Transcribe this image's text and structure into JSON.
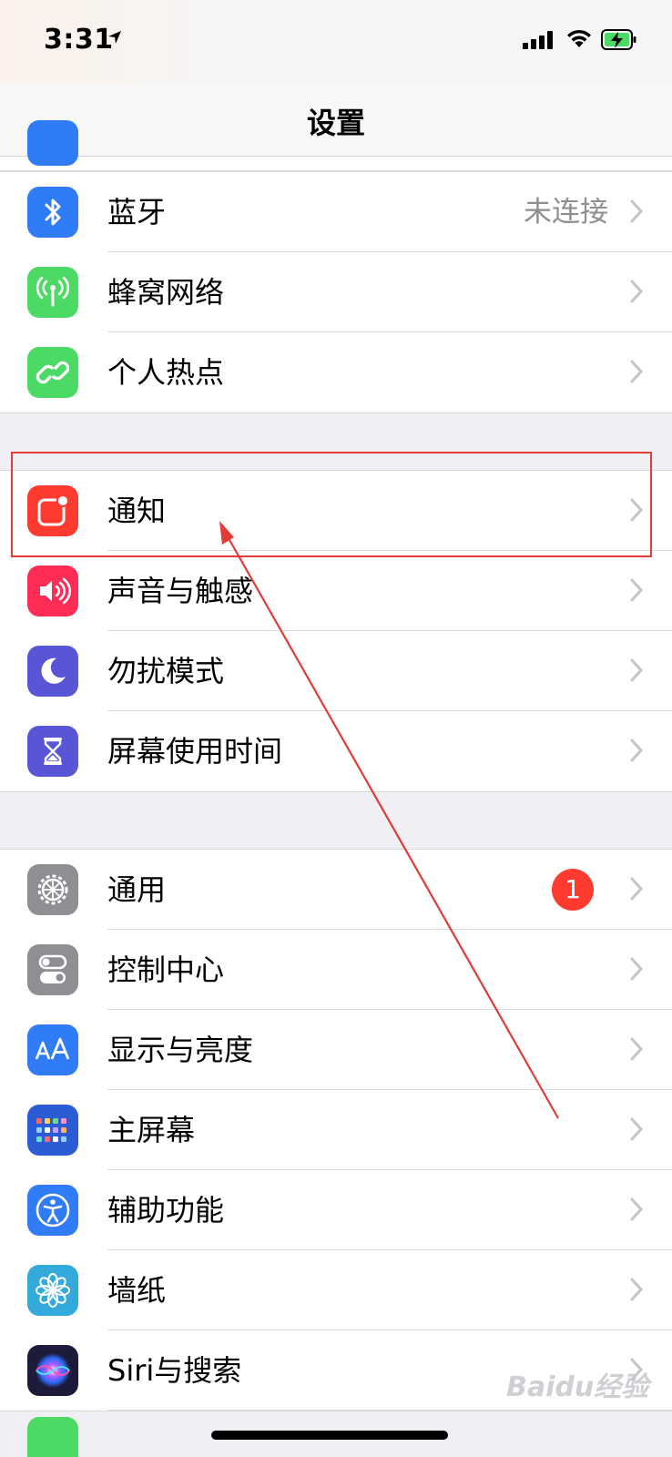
{
  "status_bar": {
    "time": "3:31",
    "location_icon": "location-arrow-icon",
    "signal_icon": "cellular-signal-icon",
    "wifi_icon": "wifi-icon",
    "battery_icon": "battery-charging-icon"
  },
  "nav": {
    "title": "设置"
  },
  "groups": [
    {
      "items": [
        {
          "label": "蓝牙",
          "value": "未连接",
          "icon": "bluetooth-icon",
          "color": "#2f7cf6"
        },
        {
          "label": "蜂窝网络",
          "icon": "antenna-icon",
          "color": "#4cd964"
        },
        {
          "label": "个人热点",
          "icon": "hotspot-link-icon",
          "color": "#4cd964"
        }
      ]
    },
    {
      "items": [
        {
          "label": "通知",
          "icon": "notifications-icon",
          "color": "#ff3b30"
        },
        {
          "label": "声音与触感",
          "icon": "speaker-icon",
          "color": "#ff2d55"
        },
        {
          "label": "勿扰模式",
          "icon": "moon-icon",
          "color": "#5856d6"
        },
        {
          "label": "屏幕使用时间",
          "icon": "hourglass-icon",
          "color": "#5856d6"
        }
      ]
    },
    {
      "items": [
        {
          "label": "通用",
          "badge": "1",
          "icon": "gear-icon",
          "color": "#8e8e93"
        },
        {
          "label": "控制中心",
          "icon": "toggles-icon",
          "color": "#8e8e93"
        },
        {
          "label": "显示与亮度",
          "icon": "text-size-icon",
          "color": "#2f7cf6"
        },
        {
          "label": "主屏幕",
          "icon": "home-grid-icon",
          "color": "#2c5bd6"
        },
        {
          "label": "辅助功能",
          "icon": "accessibility-icon",
          "color": "#2f7cf6"
        },
        {
          "label": "墙纸",
          "icon": "flower-icon",
          "color": "#34aadc"
        },
        {
          "label": "Siri与搜索",
          "icon": "siri-icon",
          "color": "#1c1c3a"
        }
      ]
    }
  ],
  "watermark": "Baidu经验"
}
